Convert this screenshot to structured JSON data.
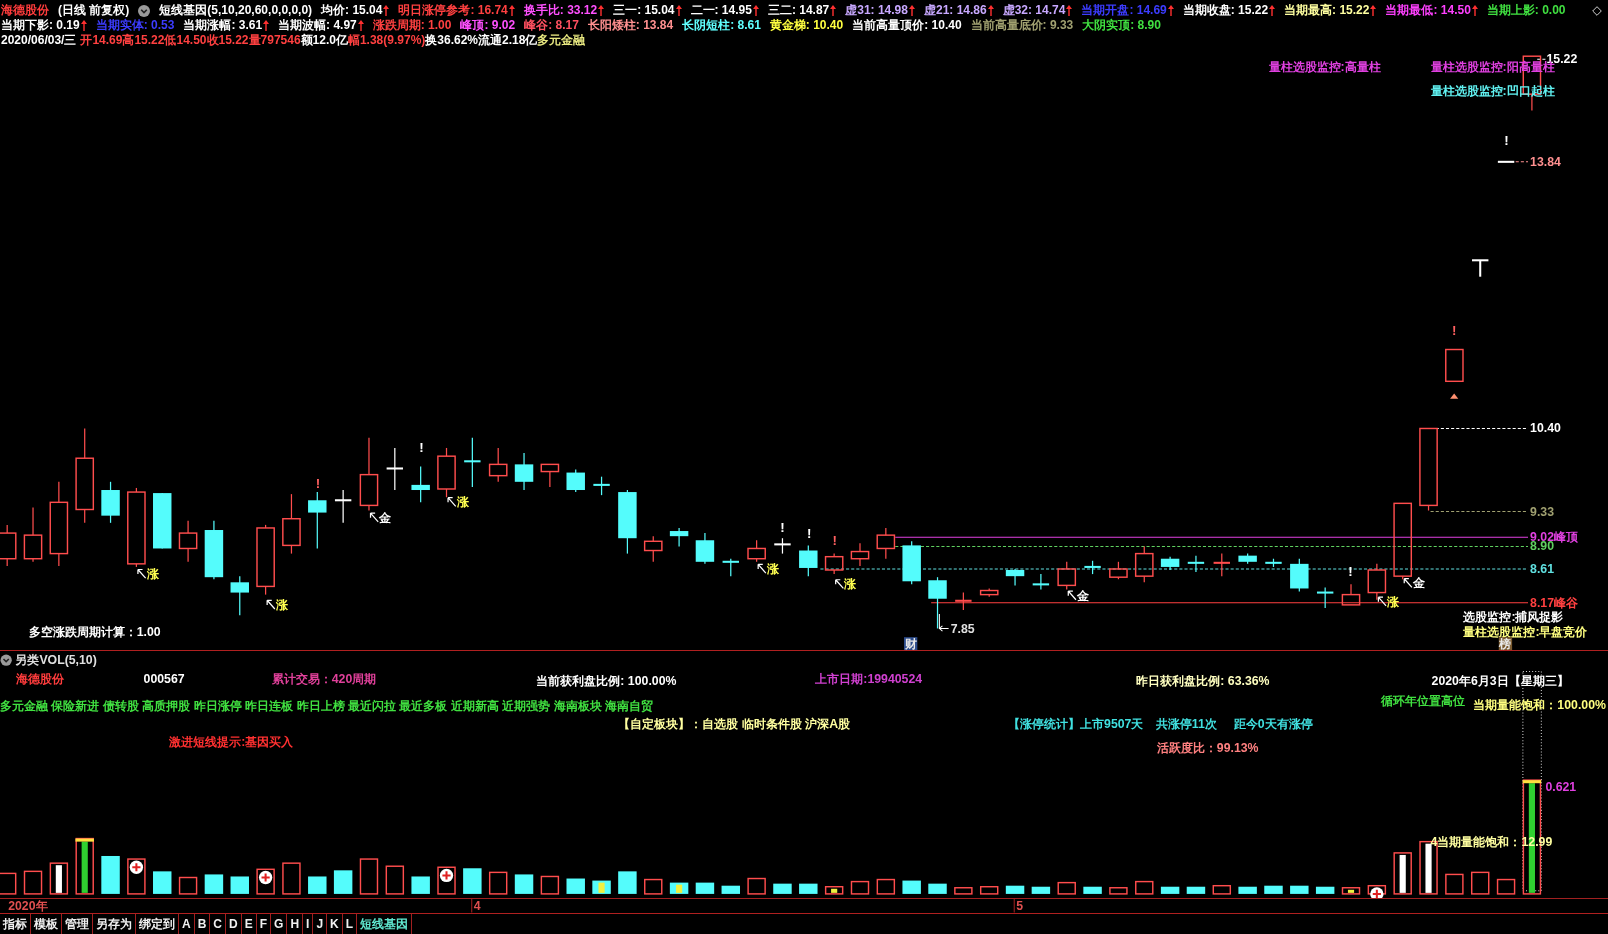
{
  "title_bar": {
    "stock_name": "海德股份",
    "period": "(日线 前复权)",
    "formula": "短线基因(5,10,20,60,0,0,0,0)"
  },
  "readout_rows": [
    [
      {
        "text": "均价: 15.04",
        "color": "#ffffff",
        "up_arrow": true
      },
      {
        "text": "明日涨停参考: 16.74",
        "color": "#ff4040",
        "up_arrow": true
      },
      {
        "text": "换手比: 33.12",
        "color": "#ff50ff",
        "up_arrow": true
      },
      {
        "text": "三一: 15.04",
        "color": "#ffffff",
        "up_arrow": true
      },
      {
        "text": "二一: 14.95",
        "color": "#ffffff",
        "up_arrow": true
      },
      {
        "text": "三二: 14.87",
        "color": "#ffffff",
        "up_arrow": true
      },
      {
        "text": "虚31: 14.98",
        "color": "#c8a8ff",
        "up_arrow": true
      },
      {
        "text": "虚21: 14.86",
        "color": "#c8a8ff",
        "up_arrow": true
      },
      {
        "text": "虚32: 14.74",
        "color": "#c8a8ff",
        "up_arrow": true
      },
      {
        "text": "当期开盘: 14.69",
        "color": "#3c3cff",
        "up_arrow": true
      },
      {
        "text": "当期收盘: 15.22",
        "color": "#ffffff",
        "up_arrow": true
      },
      {
        "text": "当期最高: 15.22",
        "color": "#ffffa0",
        "up_arrow": true
      },
      {
        "text": "当期最低: 14.50",
        "color": "#ff40ff",
        "up_arrow": true
      },
      {
        "text": "当期上影: 0.00",
        "color": "#40e040",
        "up_arrow": false
      }
    ],
    [
      {
        "text": "当期下影: 0.19",
        "color": "#ffffff",
        "up_arrow": true
      },
      {
        "text": "当期实体: 0.53",
        "color": "#3c3cff",
        "up_arrow": false
      },
      {
        "text": "当期涨幅: 3.61",
        "color": "#ffffff",
        "up_arrow": true
      },
      {
        "text": "当期波幅: 4.97",
        "color": "#ffffff",
        "up_arrow": true
      },
      {
        "text": "涨跌周期: 1.00",
        "color": "#ff4040",
        "up_arrow": false
      },
      {
        "text": "峰顶: 9.02",
        "color": "#ff50ff",
        "up_arrow": false
      },
      {
        "text": "峰谷: 8.17",
        "color": "#ff5060",
        "up_arrow": false
      },
      {
        "text": "长阳矮柱: 13.84",
        "color": "#ff9090",
        "up_arrow": false
      },
      {
        "text": "长阴短柱: 8.61",
        "color": "#60ffff",
        "up_arrow": false
      },
      {
        "text": "黄金梯: 10.40",
        "color": "#ffff40",
        "up_arrow": false
      },
      {
        "text": "当前高量顶价: 10.40",
        "color": "#ffffff",
        "up_arrow": false
      },
      {
        "text": "当前高量底价: 9.33",
        "color": "#a0a070",
        "up_arrow": false
      },
      {
        "text": "大阴实顶: 8.90",
        "color": "#40e040",
        "up_arrow": false
      }
    ]
  ],
  "quote_line": [
    {
      "text": "2020/06/03/三",
      "color": "#ffffff"
    },
    {
      "text": "开14.69",
      "color": "#ff4040"
    },
    {
      "text": "高15.22",
      "color": "#ff4040"
    },
    {
      "text": "低14.50",
      "color": "#ff4040"
    },
    {
      "text": "收15.22",
      "color": "#ff4040"
    },
    {
      "text": "量797546",
      "color": "#ff4040"
    },
    {
      "text": "额12.0亿",
      "color": "#ffffff"
    },
    {
      "text": "幅1.38(9.97%)",
      "color": "#ff4040"
    },
    {
      "text": "换36.62%",
      "color": "#ffffff"
    },
    {
      "text": "流通2.18亿",
      "color": "#ffffff"
    },
    {
      "text": "多元金融",
      "color": "#e8e880"
    }
  ],
  "main_chart": {
    "top_notes": [
      {
        "text": "量柱选股监控:高量柱",
        "color": "#e040e0"
      },
      {
        "text": "量柱选股监控:阳高量柱",
        "color": "#e040e0"
      },
      {
        "text": "量柱选股监控:凹口起柱",
        "color": "#60f0f0"
      }
    ],
    "price_levels": [
      {
        "text": "15.22",
        "color": "#ffffff"
      },
      {
        "text": "13.84",
        "color": "#ff9090"
      },
      {
        "text": "10.40",
        "color": "#ffffff"
      },
      {
        "text": "9.33",
        "color": "#a0a070"
      },
      {
        "text": "9.02峰顶",
        "color": "#e040e0"
      },
      {
        "text": "8.90",
        "color": "#60d060"
      },
      {
        "text": "8.61",
        "color": "#60e0e0"
      },
      {
        "text": "8.17峰谷",
        "color": "#ff4040"
      }
    ],
    "signals": [
      {
        "kind": "rise",
        "text": "涨"
      },
      {
        "kind": "rise",
        "text": "涨"
      },
      {
        "kind": "gold",
        "text": "金"
      },
      {
        "kind": "rise",
        "text": "涨"
      },
      {
        "kind": "rise",
        "text": "涨"
      },
      {
        "kind": "rise",
        "text": "涨"
      },
      {
        "kind": "gold",
        "text": "金"
      },
      {
        "kind": "rise",
        "text": "涨"
      },
      {
        "kind": "gold",
        "text": "金"
      }
    ],
    "alerts": [
      {
        "text": "!",
        "color": "#ff6060"
      },
      {
        "text": "!",
        "color": "#ffffff"
      },
      {
        "text": "!",
        "color": "#ffffff"
      },
      {
        "text": "!",
        "color": "#ffffff"
      },
      {
        "text": "!",
        "color": "#ff6060"
      },
      {
        "text": "!",
        "color": "#ffffff"
      },
      {
        "text": "!",
        "color": "#ff6060"
      },
      {
        "text": "!",
        "color": "#ffffff"
      }
    ],
    "low_price": "7.85",
    "cycle_note": "多空涨跌周期计算：1.00",
    "bottom_notes": [
      {
        "text": "选股监控:捕风捉影",
        "color": "#ffffff"
      },
      {
        "text": "量柱选股监控:早盘竞价",
        "color": "#ffff80"
      }
    ],
    "tags": [
      {
        "text": "财",
        "color": "#2c4c8c"
      },
      {
        "text": "榜",
        "color": "#7a5a30"
      }
    ]
  },
  "volume_panel": {
    "title": "另类VOL(5,10)",
    "notes": [
      {
        "text": "海德股份",
        "color": "#ff3c3c"
      },
      {
        "text": "000567",
        "color": "#ffffff"
      },
      {
        "text": "累计交易：420周期",
        "color": "#e0409a"
      },
      {
        "text": "当前获利盘比例: 100.00%",
        "color": "#ffffff"
      },
      {
        "text": "上市日期:19940524",
        "color": "#d040d0"
      },
      {
        "text": "昨日获利盘比例: 63.36%",
        "color": "#ffffc0"
      },
      {
        "text": "2020年6月3日【星期三】",
        "color": "#ffffff"
      },
      {
        "text": "多元金融 保险新进 债转股 高质押股 昨日涨停 昨日连板 昨日上榜 最近闪拉 最近多板 近期新高 近期强势 海南板块 海南自贸",
        "color": "#40e040"
      },
      {
        "text": "循环年位置高位",
        "color": "#40e040"
      },
      {
        "text": "当期量能饱和：100.00%",
        "color": "#ffff80"
      },
      {
        "text": "【自定板块】：自选股 临时条件股 沪深A股",
        "color": "#ffffa0"
      },
      {
        "text": "【涨停统计】上市9507天",
        "color": "#40e0e0"
      },
      {
        "text": "共涨停11次",
        "color": "#40e0e0"
      },
      {
        "text": "距今0天有涨停",
        "color": "#40e0e0"
      },
      {
        "text": "激进短线提示:基因买入",
        "color": "#ff3030"
      },
      {
        "text": "活跃度比：99.13%",
        "color": "#ff8080"
      },
      {
        "text": "0.621",
        "color": "#e040e0"
      },
      {
        "text": "4当期量能饱和：12.99",
        "color": "#ffffa0"
      }
    ]
  },
  "time_axis": [
    "2020年",
    "4",
    "5"
  ],
  "toolbar_tabs": [
    {
      "label": "指标",
      "selected": false
    },
    {
      "label": "模板",
      "selected": false
    },
    {
      "label": "管理",
      "selected": false
    },
    {
      "label": "另存为",
      "selected": false
    },
    {
      "label": "绑定到",
      "selected": false
    },
    {
      "label": "A",
      "selected": false
    },
    {
      "label": "B",
      "selected": false
    },
    {
      "label": "C",
      "selected": false
    },
    {
      "label": "D",
      "selected": false
    },
    {
      "label": "E",
      "selected": false
    },
    {
      "label": "F",
      "selected": false
    },
    {
      "label": "G",
      "selected": false
    },
    {
      "label": "H",
      "selected": false
    },
    {
      "label": "I",
      "selected": false
    },
    {
      "label": "J",
      "selected": false
    },
    {
      "label": "K",
      "selected": false
    },
    {
      "label": "L",
      "selected": false
    },
    {
      "label": "短线基因",
      "selected": true
    }
  ]
}
